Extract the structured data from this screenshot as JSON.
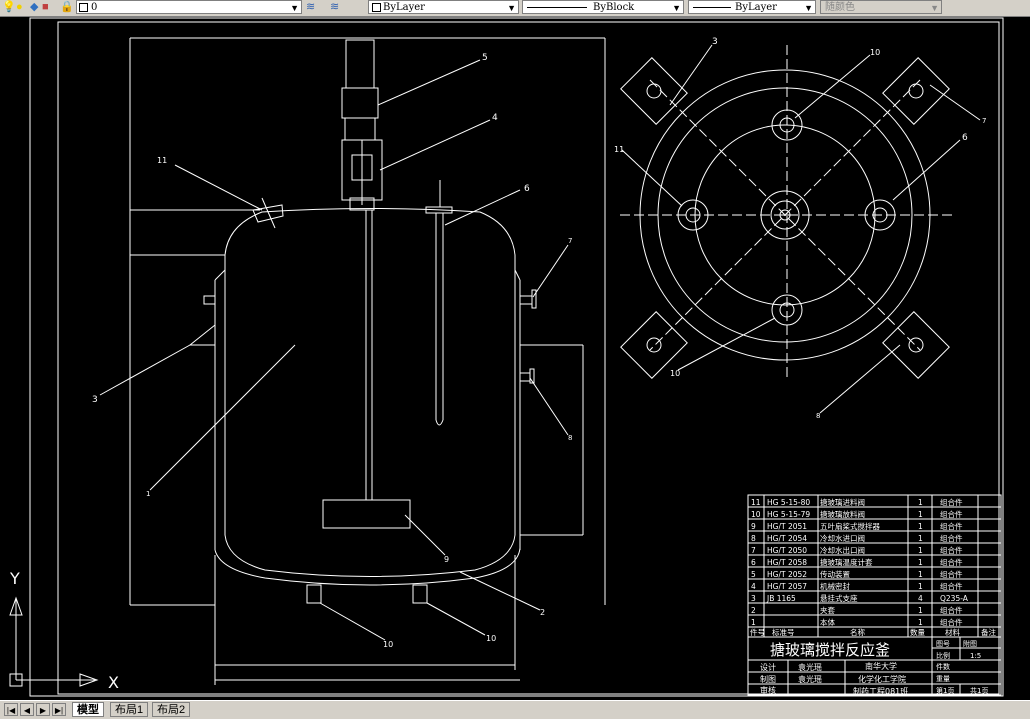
{
  "toolbar": {
    "layer_value": "0",
    "color_value": "ByLayer",
    "linetype_value": "ByBlock",
    "lineweight_value": "ByLayer",
    "plotstyle_value": "随颜色"
  },
  "tabs": [
    "模型",
    "布局1",
    "布局2"
  ],
  "ucs": {
    "y_label": "Y",
    "x_label": "X"
  },
  "balloons": {
    "b1": "1",
    "b2": "2",
    "b3": "3",
    "b4": "4",
    "b5": "5",
    "b6": "6",
    "b7": "7",
    "b8": "8",
    "b9": "9",
    "b10a": "10",
    "b10b": "10",
    "b11": "11",
    "tv3": "3",
    "tv6": "6",
    "tv7": "7",
    "tv8": "8",
    "tv10a": "10",
    "tv10b": "10",
    "tv11": "11"
  },
  "bom": {
    "rows": [
      [
        "11",
        "HG 5-15-80",
        "搪玻璃进料阀",
        "1",
        "组合件",
        ""
      ],
      [
        "10",
        "HG 5-15-79",
        "搪玻璃放料阀",
        "1",
        "组合件",
        ""
      ],
      [
        "9",
        "HG/T 2051",
        "五叶扇桨式搅拌器",
        "1",
        "组合件",
        ""
      ],
      [
        "8",
        "HG/T 2054",
        "冷却水进口阀",
        "1",
        "组合件",
        ""
      ],
      [
        "7",
        "HG/T 2050",
        "冷却水出口阀",
        "1",
        "组合件",
        ""
      ],
      [
        "6",
        "HG/T 2058",
        "搪玻璃温度计套",
        "1",
        "组合件",
        ""
      ],
      [
        "5",
        "HG/T 2052",
        "传动装置",
        "1",
        "组合件",
        ""
      ],
      [
        "4",
        "HG/T 2057",
        "机械密封",
        "1",
        "组合件",
        ""
      ],
      [
        "3",
        "JB 1165",
        "悬挂式支座",
        "4",
        "Q235-A",
        ""
      ],
      [
        "2",
        "",
        "夹套",
        "1",
        "组合件",
        ""
      ],
      [
        "1",
        "",
        "本体",
        "1",
        "组合件",
        ""
      ]
    ],
    "header": [
      "件号",
      "标准号",
      "名称",
      "数量",
      "材料",
      "备注"
    ]
  },
  "title_block": {
    "title": "搪玻璃搅拌反应釜",
    "drawing_no_label": "图号",
    "drawing_no_value": "附图",
    "scale_label": "比例",
    "scale_value": "1:5",
    "design_label": "设计",
    "design_name": "袁光瑶",
    "draw_label": "制图",
    "draw_name": "袁光瑶",
    "review_label": "审核",
    "school": "南华大学",
    "college": "化学化工学院",
    "class": "制药工程081班",
    "pieces_label": "件数",
    "weight_label": "重量",
    "sheet": "第1页",
    "total": "共1页"
  }
}
